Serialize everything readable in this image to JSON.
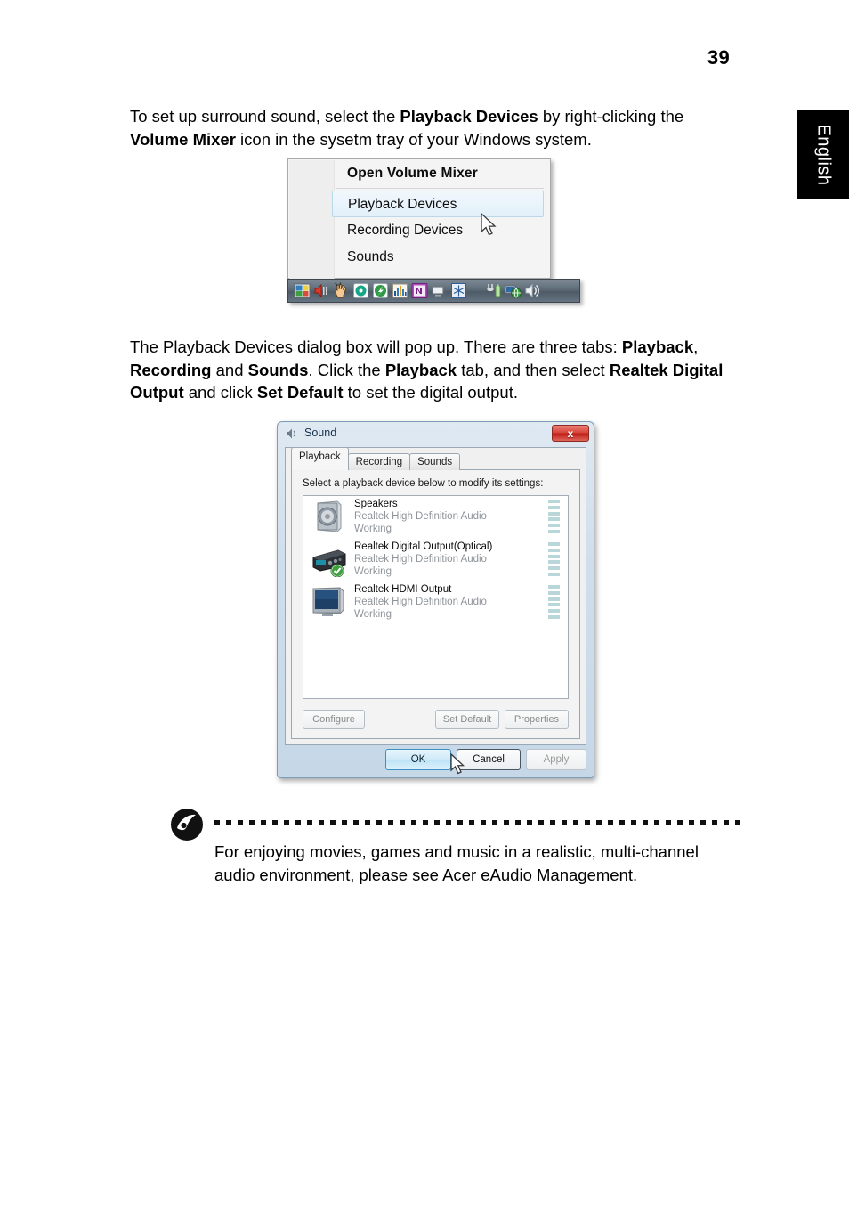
{
  "page": {
    "number": "39",
    "language_tab": "English"
  },
  "paragraphs": {
    "p1": {
      "s1": "To set up surround sound, select the ",
      "b1": "Playback Devices",
      "s2": " by right-clicking the ",
      "b2": "Volume Mixer",
      "s3": " icon in the sysetm tray of your Windows system."
    },
    "p2": {
      "s1": "The Playback Devices dialog box will pop up. There are three tabs: ",
      "b1": "Playback",
      "s2": ", ",
      "b2": "Recording",
      "s3": " and ",
      "b3": "Sounds",
      "s4": ". Click the ",
      "b4": "Playback",
      "s5": " tab, and then select ",
      "b5": "Realtek Digital Output",
      "s6": " and click ",
      "b6": "Set Default",
      "s7": " to set the digital output."
    }
  },
  "context_menu": {
    "header_item": "Open Volume Mixer",
    "items": [
      {
        "label": "Playback Devices",
        "selected": true
      },
      {
        "label": "Recording Devices",
        "selected": false
      },
      {
        "label": "Sounds",
        "selected": false
      }
    ],
    "tray_icons": [
      "display-settings-icon",
      "speaker-mute-icon",
      "hand-pointer-icon",
      "cd-disc-icon",
      "green-arrow-icon",
      "equalizer-icon",
      "nvidia-icon",
      "monitor-icon",
      "snowflake-icon",
      "battery-plug-icon",
      "network-globe-icon",
      "volume-icon"
    ]
  },
  "sound_dialog": {
    "title": "Sound",
    "title_icon": "speaker-icon",
    "close_label": "x",
    "tabs": [
      {
        "label": "Playback",
        "active": true
      },
      {
        "label": "Recording",
        "active": false
      },
      {
        "label": "Sounds",
        "active": false
      }
    ],
    "panel_label": "Select a playback device below to modify its settings:",
    "devices": [
      {
        "icon": "speakers-icon",
        "name": "Speakers",
        "driver": "Realtek High Definition Audio",
        "status": "Working",
        "is_default": false
      },
      {
        "icon": "digital-output-icon",
        "name": "Realtek Digital Output(Optical)",
        "driver": "Realtek High Definition Audio",
        "status": "Working",
        "is_default": true
      },
      {
        "icon": "hdmi-display-icon",
        "name": "Realtek HDMI Output",
        "driver": "Realtek High Definition Audio",
        "status": "Working",
        "is_default": false
      }
    ],
    "device_buttons": {
      "configure": "Configure",
      "set_default": "Set Default",
      "properties": "Properties"
    },
    "dialog_buttons": {
      "ok": "OK",
      "cancel": "Cancel",
      "apply": "Apply"
    }
  },
  "note": {
    "icon": "acer-note-icon",
    "line1": "For enjoying movies, games and music in a realistic, multi-channel",
    "line2": "audio environment, please see Acer eAudio Management."
  },
  "colors": {
    "language_tab_bg": "#000000",
    "menu_selected": "#e2f0fa",
    "close_button": "#bf2018",
    "vu_meter": "#b9d6d9",
    "default_badge": "#3f9f3f"
  }
}
